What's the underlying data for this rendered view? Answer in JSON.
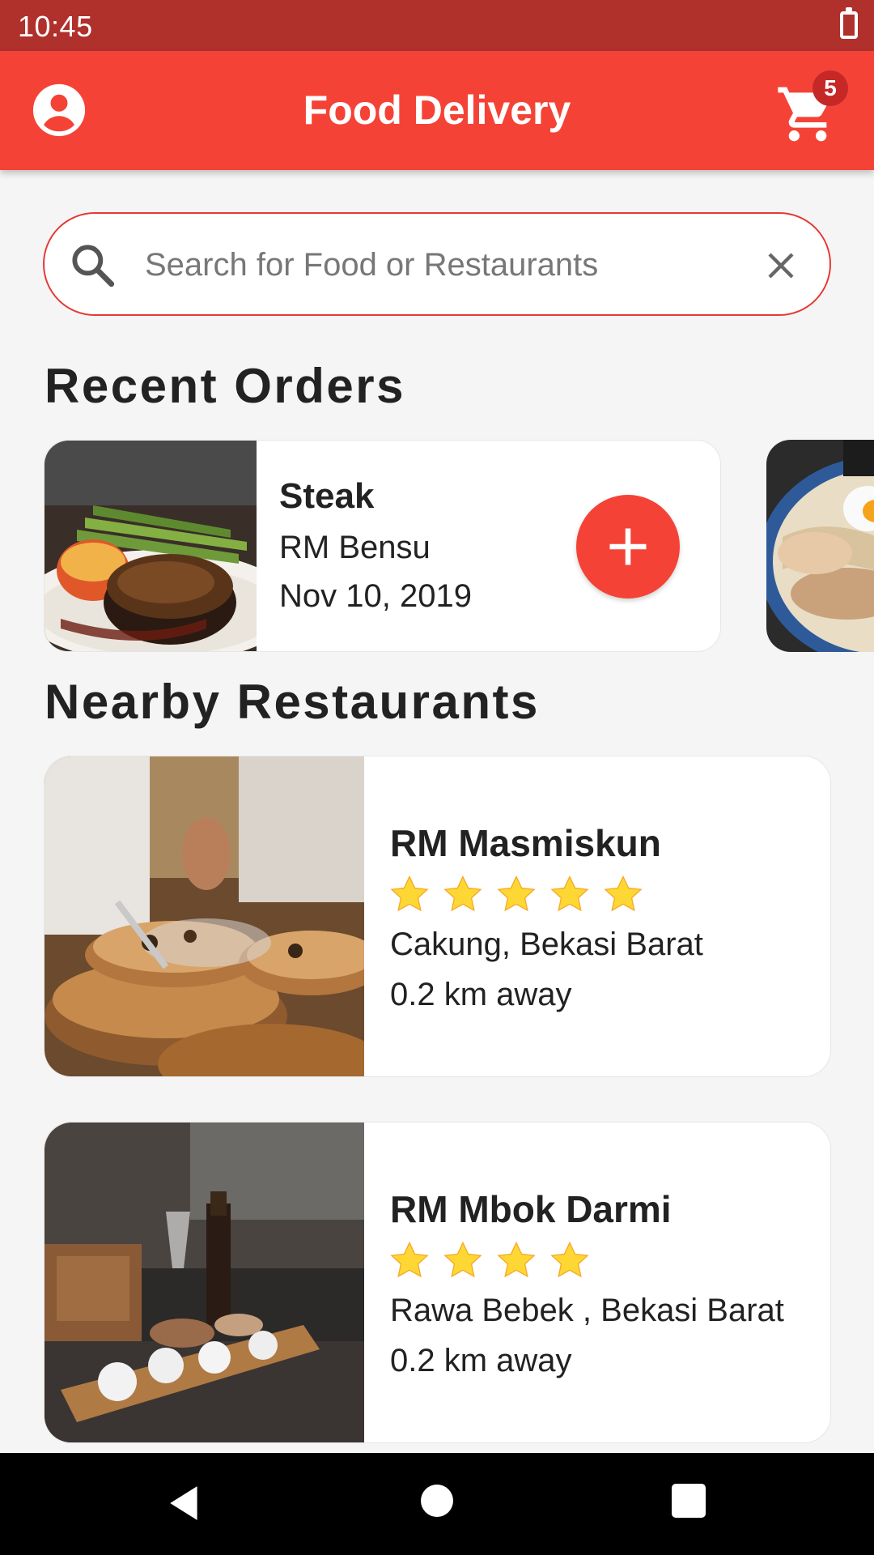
{
  "status_bar": {
    "time": "10:45"
  },
  "app_bar": {
    "title": "Food Delivery",
    "cart_count": "5"
  },
  "search": {
    "placeholder": "Search for Food or Restaurants",
    "value": ""
  },
  "recent_orders": {
    "title": "Recent Orders",
    "items": [
      {
        "name": "Steak",
        "restaurant": "RM Bensu",
        "date": "Nov 10, 2019"
      }
    ]
  },
  "nearby": {
    "title": "Nearby Restaurants",
    "items": [
      {
        "name": "RM Masmiskun",
        "rating": 5,
        "location": "Cakung, Bekasi Barat",
        "distance": "0.2 km away"
      },
      {
        "name": "RM Mbok Darmi",
        "rating": 4,
        "location": "Rawa Bebek , Bekasi Barat",
        "distance": "0.2 km away"
      }
    ]
  },
  "colors": {
    "primary": "#f44336",
    "status_bar": "#b0302c",
    "badge": "#c62828",
    "star": "#fdd835"
  }
}
